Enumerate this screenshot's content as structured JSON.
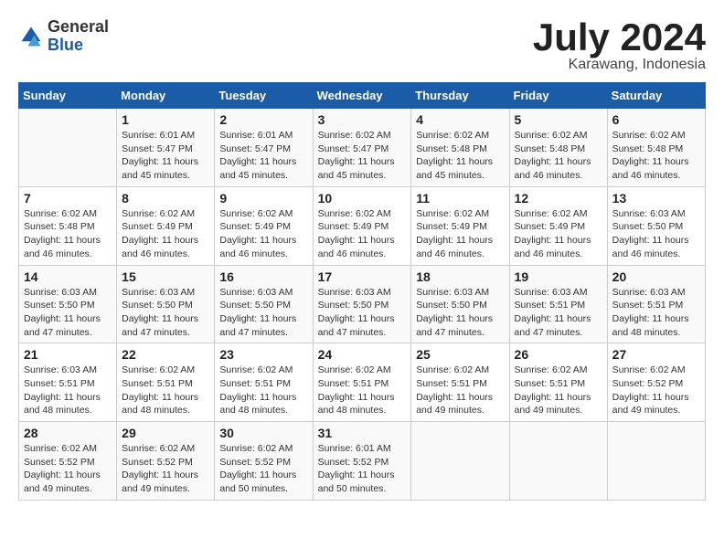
{
  "header": {
    "logo_general": "General",
    "logo_blue": "Blue",
    "month_title": "July 2024",
    "location": "Karawang, Indonesia"
  },
  "weekdays": [
    "Sunday",
    "Monday",
    "Tuesday",
    "Wednesday",
    "Thursday",
    "Friday",
    "Saturday"
  ],
  "weeks": [
    [
      {
        "day": "",
        "info": ""
      },
      {
        "day": "1",
        "info": "Sunrise: 6:01 AM\nSunset: 5:47 PM\nDaylight: 11 hours\nand 45 minutes."
      },
      {
        "day": "2",
        "info": "Sunrise: 6:01 AM\nSunset: 5:47 PM\nDaylight: 11 hours\nand 45 minutes."
      },
      {
        "day": "3",
        "info": "Sunrise: 6:02 AM\nSunset: 5:47 PM\nDaylight: 11 hours\nand 45 minutes."
      },
      {
        "day": "4",
        "info": "Sunrise: 6:02 AM\nSunset: 5:48 PM\nDaylight: 11 hours\nand 45 minutes."
      },
      {
        "day": "5",
        "info": "Sunrise: 6:02 AM\nSunset: 5:48 PM\nDaylight: 11 hours\nand 46 minutes."
      },
      {
        "day": "6",
        "info": "Sunrise: 6:02 AM\nSunset: 5:48 PM\nDaylight: 11 hours\nand 46 minutes."
      }
    ],
    [
      {
        "day": "7",
        "info": "Sunrise: 6:02 AM\nSunset: 5:48 PM\nDaylight: 11 hours\nand 46 minutes."
      },
      {
        "day": "8",
        "info": "Sunrise: 6:02 AM\nSunset: 5:49 PM\nDaylight: 11 hours\nand 46 minutes."
      },
      {
        "day": "9",
        "info": "Sunrise: 6:02 AM\nSunset: 5:49 PM\nDaylight: 11 hours\nand 46 minutes."
      },
      {
        "day": "10",
        "info": "Sunrise: 6:02 AM\nSunset: 5:49 PM\nDaylight: 11 hours\nand 46 minutes."
      },
      {
        "day": "11",
        "info": "Sunrise: 6:02 AM\nSunset: 5:49 PM\nDaylight: 11 hours\nand 46 minutes."
      },
      {
        "day": "12",
        "info": "Sunrise: 6:02 AM\nSunset: 5:49 PM\nDaylight: 11 hours\nand 46 minutes."
      },
      {
        "day": "13",
        "info": "Sunrise: 6:03 AM\nSunset: 5:50 PM\nDaylight: 11 hours\nand 46 minutes."
      }
    ],
    [
      {
        "day": "14",
        "info": "Sunrise: 6:03 AM\nSunset: 5:50 PM\nDaylight: 11 hours\nand 47 minutes."
      },
      {
        "day": "15",
        "info": "Sunrise: 6:03 AM\nSunset: 5:50 PM\nDaylight: 11 hours\nand 47 minutes."
      },
      {
        "day": "16",
        "info": "Sunrise: 6:03 AM\nSunset: 5:50 PM\nDaylight: 11 hours\nand 47 minutes."
      },
      {
        "day": "17",
        "info": "Sunrise: 6:03 AM\nSunset: 5:50 PM\nDaylight: 11 hours\nand 47 minutes."
      },
      {
        "day": "18",
        "info": "Sunrise: 6:03 AM\nSunset: 5:50 PM\nDaylight: 11 hours\nand 47 minutes."
      },
      {
        "day": "19",
        "info": "Sunrise: 6:03 AM\nSunset: 5:51 PM\nDaylight: 11 hours\nand 47 minutes."
      },
      {
        "day": "20",
        "info": "Sunrise: 6:03 AM\nSunset: 5:51 PM\nDaylight: 11 hours\nand 48 minutes."
      }
    ],
    [
      {
        "day": "21",
        "info": "Sunrise: 6:03 AM\nSunset: 5:51 PM\nDaylight: 11 hours\nand 48 minutes."
      },
      {
        "day": "22",
        "info": "Sunrise: 6:02 AM\nSunset: 5:51 PM\nDaylight: 11 hours\nand 48 minutes."
      },
      {
        "day": "23",
        "info": "Sunrise: 6:02 AM\nSunset: 5:51 PM\nDaylight: 11 hours\nand 48 minutes."
      },
      {
        "day": "24",
        "info": "Sunrise: 6:02 AM\nSunset: 5:51 PM\nDaylight: 11 hours\nand 48 minutes."
      },
      {
        "day": "25",
        "info": "Sunrise: 6:02 AM\nSunset: 5:51 PM\nDaylight: 11 hours\nand 49 minutes."
      },
      {
        "day": "26",
        "info": "Sunrise: 6:02 AM\nSunset: 5:51 PM\nDaylight: 11 hours\nand 49 minutes."
      },
      {
        "day": "27",
        "info": "Sunrise: 6:02 AM\nSunset: 5:52 PM\nDaylight: 11 hours\nand 49 minutes."
      }
    ],
    [
      {
        "day": "28",
        "info": "Sunrise: 6:02 AM\nSunset: 5:52 PM\nDaylight: 11 hours\nand 49 minutes."
      },
      {
        "day": "29",
        "info": "Sunrise: 6:02 AM\nSunset: 5:52 PM\nDaylight: 11 hours\nand 49 minutes."
      },
      {
        "day": "30",
        "info": "Sunrise: 6:02 AM\nSunset: 5:52 PM\nDaylight: 11 hours\nand 50 minutes."
      },
      {
        "day": "31",
        "info": "Sunrise: 6:01 AM\nSunset: 5:52 PM\nDaylight: 11 hours\nand 50 minutes."
      },
      {
        "day": "",
        "info": ""
      },
      {
        "day": "",
        "info": ""
      },
      {
        "day": "",
        "info": ""
      }
    ]
  ]
}
